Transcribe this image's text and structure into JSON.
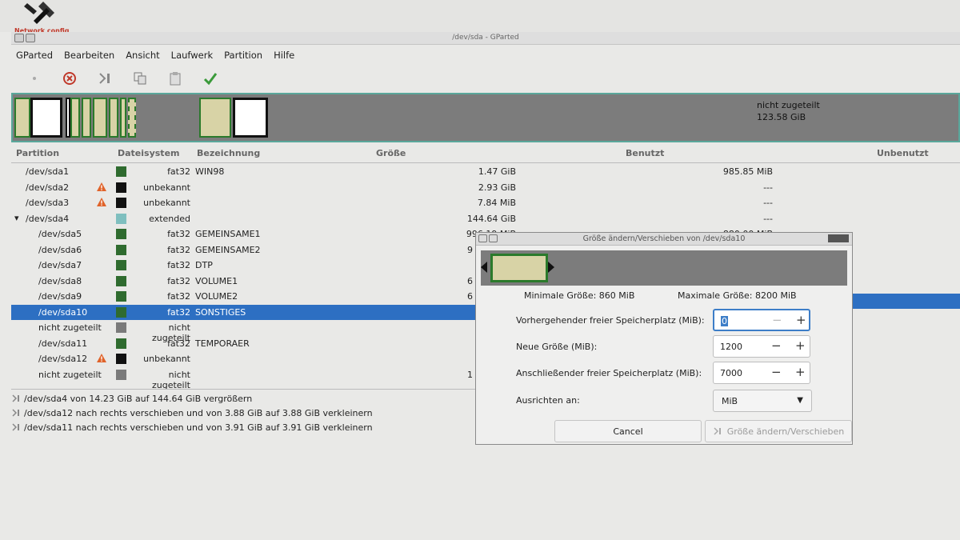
{
  "desktop": {
    "icon_label": "Network config"
  },
  "window": {
    "title": "/dev/sda - GParted"
  },
  "menu": [
    "GParted",
    "Bearbeiten",
    "Ansicht",
    "Laufwerk",
    "Partition",
    "Hilfe"
  ],
  "columns": {
    "partition": "Partition",
    "filesystem": "Dateisystem",
    "label": "Bezeichnung",
    "size": "Größe",
    "used": "Benutzt",
    "unused": "Unbenutzt"
  },
  "diskmap": {
    "unallocated_label": "nicht zugeteilt",
    "unallocated_size": "123.58 GiB"
  },
  "rows": [
    {
      "partition": "/dev/sda1",
      "indent": false,
      "warn": false,
      "swatch": "#2f6b2f",
      "fs": "fat32",
      "label": "WIN98",
      "size": "1.47 GiB",
      "used": "985.85 MiB"
    },
    {
      "partition": "/dev/sda2",
      "indent": false,
      "warn": true,
      "swatch": "#111111",
      "fs": "unbekannt",
      "label": "",
      "size": "2.93 GiB",
      "used": "---"
    },
    {
      "partition": "/dev/sda3",
      "indent": false,
      "warn": true,
      "swatch": "#111111",
      "fs": "unbekannt",
      "label": "",
      "size": "7.84 MiB",
      "used": "---"
    },
    {
      "partition": "/dev/sda4",
      "indent": false,
      "expander": "▾",
      "warn": false,
      "swatch": "#7fbfbf",
      "fs": "extended",
      "label": "",
      "size": "144.64 GiB",
      "used": "---"
    },
    {
      "partition": "/dev/sda5",
      "indent": true,
      "warn": false,
      "swatch": "#2f6b2f",
      "fs": "fat32",
      "label": "GEMEINSAME1",
      "size": "996.19 MiB",
      "used": "880.00 MiB"
    },
    {
      "partition": "/dev/sda6",
      "indent": true,
      "warn": false,
      "swatch": "#2f6b2f",
      "fs": "fat32",
      "label": "GEMEINSAME2",
      "size": "9",
      "used": ""
    },
    {
      "partition": "/dev/sda7",
      "indent": true,
      "warn": false,
      "swatch": "#2f6b2f",
      "fs": "fat32",
      "label": "DTP",
      "size": "",
      "used": ""
    },
    {
      "partition": "/dev/sda8",
      "indent": true,
      "warn": false,
      "swatch": "#2f6b2f",
      "fs": "fat32",
      "label": "VOLUME1",
      "size": "6",
      "used": ""
    },
    {
      "partition": "/dev/sda9",
      "indent": true,
      "warn": false,
      "swatch": "#2f6b2f",
      "fs": "fat32",
      "label": "VOLUME2",
      "size": "6",
      "used": ""
    },
    {
      "partition": "/dev/sda10",
      "indent": true,
      "warn": false,
      "swatch": "#2f6b2f",
      "fs": "fat32",
      "label": "SONSTIGES",
      "size": "",
      "used": "",
      "selected": true
    },
    {
      "partition": "nicht zugeteilt",
      "indent": true,
      "warn": false,
      "swatch": "#7a7a7a",
      "fs": "nicht zugeteilt",
      "label": "",
      "size": "",
      "used": ""
    },
    {
      "partition": "/dev/sda11",
      "indent": true,
      "warn": false,
      "swatch": "#2f6b2f",
      "fs": "fat32",
      "label": "TEMPORAER",
      "size": "",
      "used": ""
    },
    {
      "partition": "/dev/sda12",
      "indent": true,
      "warn": true,
      "swatch": "#111111",
      "fs": "unbekannt",
      "label": "",
      "size": "",
      "used": ""
    },
    {
      "partition": "nicht zugeteilt",
      "indent": true,
      "warn": false,
      "swatch": "#7a7a7a",
      "fs": "nicht zugeteilt",
      "label": "",
      "size": "1",
      "used": ""
    }
  ],
  "pending": [
    "/dev/sda4 von 14.23 GiB auf 144.64 GiB vergrößern",
    "/dev/sda12 nach rechts verschieben und von 3.88 GiB auf 3.88 GiB verkleinern",
    "/dev/sda11 nach rechts verschieben und von 3.91 GiB auf 3.91 GiB verkleinern"
  ],
  "dialog": {
    "title": "Größe ändern/Verschieben von /dev/sda10",
    "min_size": "Minimale Größe: 860 MiB",
    "max_size": "Maximale Größe: 8200 MiB",
    "preceding_label": "Vorhergehender freier Speicherplatz (MiB):",
    "preceding_value": "0",
    "new_size_label": "Neue Größe (MiB):",
    "new_size_value": "1200",
    "following_label": "Anschließender freier Speicherplatz (MiB):",
    "following_value": "7000",
    "align_label": "Ausrichten an:",
    "align_value": "MiB",
    "cancel_label": "Cancel",
    "apply_label": "Größe ändern/Verschieben"
  },
  "colors": {
    "selection": "#2d6fc2",
    "fat32": "#2f6b2f",
    "extended": "#7fbfbf",
    "unallocated": "#7a7a7a",
    "map_border": "#5aa79b"
  }
}
